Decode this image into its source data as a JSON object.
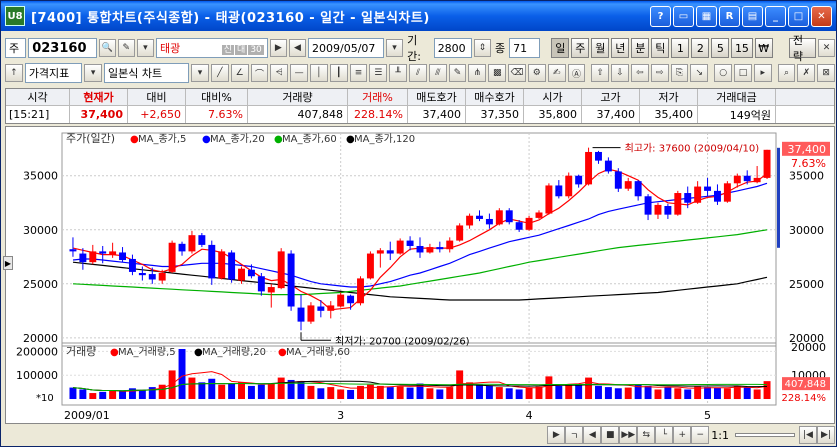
{
  "window": {
    "title": "[7400] 통합차트(주식종합) - 태광(023160 - 일간 - 일본식차트)",
    "app_icon": "U8",
    "buttons": [
      "?",
      "▭",
      "▦",
      "R",
      "▤",
      "_",
      "□",
      "✕"
    ]
  },
  "toolbar1": {
    "market_label": "주",
    "code_value": "023160",
    "name_value": "태광",
    "name_badges": [
      "신",
      "대",
      "30"
    ],
    "date_value": "2009/05/07",
    "period_label": "기간:",
    "period_value": "2800",
    "count_label": "종",
    "count_value": "71",
    "interval_buttons": [
      "일",
      "주",
      "월",
      "년",
      "분",
      "틱",
      "1",
      "2",
      "5",
      "15",
      "₩"
    ],
    "strategy_label": "전략"
  },
  "toolbar2": {
    "indicator_label": "가격지표",
    "chart_type_value": "일본식 차트"
  },
  "quote": {
    "headers": [
      "시각",
      "현재가",
      "대비",
      "대비%",
      "거래량",
      "거래%",
      "매도호가",
      "매수호가",
      "시가",
      "고가",
      "저가",
      "거래대금"
    ],
    "values": [
      "[15:21]",
      "37,400",
      "+2,650",
      "7.63%",
      "407,848",
      "228.14%",
      "37,400",
      "37,350",
      "35,800",
      "37,400",
      "35,400",
      "149억원"
    ]
  },
  "colors": {
    "up": "#ff0000",
    "down": "#0000ff",
    "ma5": "#ff0000",
    "ma20": "#0000ff",
    "ma60": "#00b000",
    "ma120": "#000000"
  },
  "chart_data": {
    "type": "candlestick",
    "price_legend": {
      "label": "주가(일간)",
      "series": [
        "MA_종가,5",
        "MA_종가,20",
        "MA_종가,60",
        "MA_종가,120"
      ]
    },
    "volume_legend": {
      "label": "거래량",
      "series": [
        "MA_거래량,5",
        "MA_거래량,20",
        "MA_거래량,60"
      ]
    },
    "price_ticks": [
      20000,
      25000,
      30000,
      35000
    ],
    "volume_ticks": [
      100000,
      200000
    ],
    "volume_tick_labels": [
      "100000",
      "200000"
    ],
    "volume_right_ticks": [
      "20000",
      "10000"
    ],
    "volume_multiplier": "*10",
    "x_labels": [
      "2009/01",
      "3",
      "4",
      "5"
    ],
    "high_annotation": "최고가: 37600 (2009/04/10)",
    "low_annotation": "최저가: 20700 (2009/02/26)",
    "last_price_tag": "37,400",
    "last_change_tag": "7.63%",
    "last_volume_tag": "407,848",
    "last_volume_pct_tag": "228.14%",
    "ohlc": [
      [
        28200,
        29300,
        27500,
        28000
      ],
      [
        27800,
        28300,
        26300,
        27000
      ],
      [
        27000,
        28600,
        26800,
        28000
      ],
      [
        28000,
        28500,
        26900,
        27800
      ],
      [
        27700,
        28800,
        27400,
        28000
      ],
      [
        27900,
        28400,
        27000,
        27200
      ],
      [
        27300,
        27700,
        25800,
        26100
      ],
      [
        26000,
        26600,
        25300,
        25800
      ],
      [
        25900,
        26500,
        25000,
        25400
      ],
      [
        25300,
        26300,
        25000,
        26000
      ],
      [
        26100,
        29000,
        26000,
        28800
      ],
      [
        28700,
        28900,
        27600,
        28000
      ],
      [
        28000,
        29900,
        27800,
        29500
      ],
      [
        29500,
        29700,
        28400,
        28600
      ],
      [
        28600,
        29000,
        24900,
        25500
      ],
      [
        25500,
        28200,
        25400,
        28000
      ],
      [
        27900,
        28100,
        25100,
        25400
      ],
      [
        25300,
        26600,
        25000,
        26400
      ],
      [
        26300,
        26800,
        25500,
        25700
      ],
      [
        25700,
        26000,
        23900,
        24300
      ],
      [
        24200,
        25000,
        22800,
        24700
      ],
      [
        24600,
        28300,
        24500,
        28000
      ],
      [
        27800,
        28100,
        22500,
        22900
      ],
      [
        22800,
        24000,
        20700,
        21500
      ],
      [
        21500,
        23300,
        21300,
        23000
      ],
      [
        22900,
        23500,
        21900,
        22500
      ],
      [
        22500,
        23400,
        21800,
        23000
      ],
      [
        22900,
        24200,
        22800,
        24000
      ],
      [
        23900,
        24000,
        22600,
        23200
      ],
      [
        23200,
        25700,
        23000,
        25500
      ],
      [
        25500,
        28000,
        25400,
        27800
      ],
      [
        27800,
        28300,
        26500,
        28100
      ],
      [
        28100,
        28900,
        27200,
        27800
      ],
      [
        27800,
        29200,
        27700,
        29000
      ],
      [
        29000,
        29400,
        28100,
        28500
      ],
      [
        28500,
        29300,
        27400,
        27900
      ],
      [
        27900,
        28700,
        27800,
        28400
      ],
      [
        28400,
        28900,
        27900,
        28200
      ],
      [
        28200,
        29300,
        27900,
        29000
      ],
      [
        29000,
        30600,
        28900,
        30400
      ],
      [
        30400,
        31500,
        30100,
        31300
      ],
      [
        31300,
        31800,
        30800,
        31000
      ],
      [
        31000,
        31500,
        30100,
        30500
      ],
      [
        30500,
        32000,
        30400,
        31800
      ],
      [
        31800,
        32000,
        30500,
        30700
      ],
      [
        30700,
        30900,
        29800,
        30000
      ],
      [
        30000,
        31300,
        29900,
        31100
      ],
      [
        31100,
        31800,
        31000,
        31600
      ],
      [
        31500,
        34300,
        31400,
        34100
      ],
      [
        34100,
        34600,
        32900,
        33100
      ],
      [
        33100,
        35300,
        32900,
        35000
      ],
      [
        35000,
        35100,
        33900,
        34200
      ],
      [
        34200,
        37600,
        34100,
        37200
      ],
      [
        37200,
        37300,
        36100,
        36400
      ],
      [
        36400,
        36700,
        35200,
        35400
      ],
      [
        35400,
        35700,
        33500,
        33800
      ],
      [
        33800,
        34800,
        33600,
        34500
      ],
      [
        34500,
        34600,
        32700,
        33100
      ],
      [
        33100,
        33300,
        30900,
        31400
      ],
      [
        31400,
        32500,
        31000,
        32300
      ],
      [
        32200,
        32400,
        31000,
        31400
      ],
      [
        31400,
        33600,
        31300,
        33400
      ],
      [
        33400,
        34000,
        32000,
        32500
      ],
      [
        32500,
        34500,
        32400,
        34000
      ],
      [
        34000,
        34800,
        33100,
        33600
      ],
      [
        33600,
        34200,
        32300,
        32600
      ],
      [
        32600,
        34500,
        32500,
        34300
      ],
      [
        34300,
        35200,
        33900,
        35000
      ],
      [
        35000,
        35500,
        34200,
        34500
      ],
      [
        34400,
        35900,
        34300,
        34800
      ],
      [
        34800,
        37400,
        34700,
        37400
      ]
    ],
    "volume": [
      48000,
      40000,
      25000,
      30000,
      35000,
      32000,
      45000,
      38000,
      50000,
      60000,
      120000,
      210000,
      90000,
      70000,
      85000,
      60000,
      65000,
      70000,
      55000,
      60000,
      65000,
      90000,
      80000,
      75000,
      55000,
      45000,
      50000,
      40000,
      38000,
      55000,
      60000,
      55000,
      50000,
      52000,
      48000,
      65000,
      45000,
      40000,
      50000,
      120000,
      70000,
      60000,
      55000,
      50000,
      45000,
      40000,
      48000,
      52000,
      95000,
      55000,
      60000,
      60000,
      90000,
      55000,
      50000,
      45000,
      48000,
      60000,
      55000,
      40000,
      50000,
      45000,
      40000,
      52000,
      50000,
      48000,
      45000,
      55000,
      50000,
      40000,
      75000
    ],
    "ma": {
      "ma5": [
        28300,
        28100,
        27900,
        27700,
        27700,
        27600,
        27200,
        26800,
        26300,
        26100,
        26400,
        26800,
        27600,
        28200,
        28100,
        27900,
        27400,
        26800,
        26200,
        25600,
        25300,
        25400,
        24900,
        24300,
        23900,
        23400,
        22600,
        22700,
        22800,
        23600,
        24400,
        25600,
        26500,
        27500,
        28200,
        28300,
        28300,
        28300,
        28300,
        28600,
        29000,
        29500,
        30000,
        30600,
        31000,
        30800,
        30600,
        30900,
        31500,
        32000,
        32700,
        33500,
        34400,
        35200,
        35600,
        35400,
        35000,
        34600,
        33700,
        33000,
        32500,
        32400,
        32300,
        32700,
        33000,
        33100,
        33500,
        34000,
        34400,
        34500,
        35200
      ],
      "ma20": [
        27200,
        27300,
        27300,
        27200,
        27100,
        27000,
        26900,
        26800,
        26700,
        26600,
        26600,
        26700,
        26800,
        26900,
        26900,
        26900,
        26800,
        26700,
        26600,
        26400,
        26200,
        26000,
        25800,
        25500,
        25200,
        25000,
        24900,
        24800,
        24700,
        24700,
        24800,
        25000,
        25200,
        25500,
        25800,
        26000,
        26300,
        26600,
        26900,
        27300,
        27700,
        28000,
        28300,
        28600,
        28900,
        29100,
        29300,
        29500,
        29800,
        30100,
        30400,
        30700,
        31000,
        31400,
        31700,
        31900,
        32100,
        32300,
        32500,
        32600,
        32700,
        32800,
        32900,
        33000,
        33100,
        33200,
        33400,
        33600,
        33800,
        34000,
        34300
      ],
      "ma60": [
        25000,
        24950,
        24900,
        24850,
        24800,
        24750,
        24700,
        24650,
        24600,
        24550,
        24500,
        24450,
        24400,
        24350,
        24300,
        24250,
        24200,
        24150,
        24100,
        24050,
        24000,
        24000,
        24000,
        24000,
        24050,
        24100,
        24150,
        24200,
        24300,
        24400,
        24500,
        24600,
        24700,
        24800,
        24950,
        25100,
        25250,
        25400,
        25550,
        25700,
        25850,
        26000,
        26200,
        26400,
        26600,
        26800,
        27000,
        27150,
        27300,
        27450,
        27600,
        27750,
        27900,
        28050,
        28200,
        28350,
        28450,
        28550,
        28650,
        28750,
        28850,
        28950,
        29050,
        29150,
        29250,
        29350,
        29450,
        29550,
        29700,
        29850,
        30000
      ],
      "ma120": [
        27000,
        26900,
        26800,
        26700,
        26600,
        26500,
        26400,
        26300,
        26200,
        26100,
        26000,
        25900,
        25800,
        25700,
        25600,
        25500,
        25400,
        25300,
        25200,
        25100,
        25000,
        24900,
        24800,
        24700,
        24600,
        24500,
        24400,
        24300,
        24200,
        24100,
        24000,
        23900,
        23800,
        23750,
        23700,
        23650,
        23600,
        23550,
        23500,
        23500,
        23500,
        23500,
        23500,
        23500,
        23500,
        23500,
        23550,
        23600,
        23650,
        23700,
        23750,
        23800,
        23850,
        23900,
        23950,
        24000,
        24050,
        24100,
        24150,
        24200,
        24300,
        24400,
        24500,
        24600,
        24700,
        24800,
        24900,
        25000,
        25200,
        25400,
        25600
      ]
    }
  },
  "bottombar": {
    "zoom_label": "1:1",
    "buttons": [
      "▶",
      "ㄱ",
      "◀",
      "■",
      "▶▶",
      "⇆",
      "└",
      "+",
      "−"
    ]
  }
}
